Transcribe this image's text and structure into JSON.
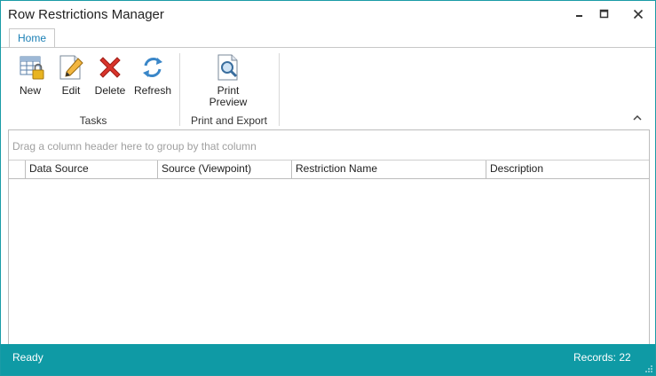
{
  "window": {
    "title": "Row Restrictions Manager"
  },
  "tabs": [
    {
      "label": "Home"
    }
  ],
  "ribbon": {
    "buttons": [
      {
        "label": "New",
        "icon": "new-grid-lock-icon"
      },
      {
        "label": "Edit",
        "icon": "edit-pencil-icon"
      },
      {
        "label": "Delete",
        "icon": "delete-x-icon"
      },
      {
        "label": "Refresh",
        "icon": "refresh-icon"
      },
      {
        "label_line1": "Print",
        "label_line2": "Preview",
        "icon": "print-preview-icon"
      }
    ],
    "groups": [
      {
        "label": "Tasks"
      },
      {
        "label": "Print and Export"
      }
    ]
  },
  "grid": {
    "group_panel_text": "Drag a column header here to group by that column",
    "columns": [
      "Data Source",
      "Source (Viewpoint)",
      "Restriction Name",
      "Description"
    ]
  },
  "status": {
    "left": "Ready",
    "right": "Records: 22"
  },
  "colors": {
    "accent": "#0f9aa5",
    "tab_text": "#1a7fb5",
    "delete_red": "#d9342b"
  }
}
